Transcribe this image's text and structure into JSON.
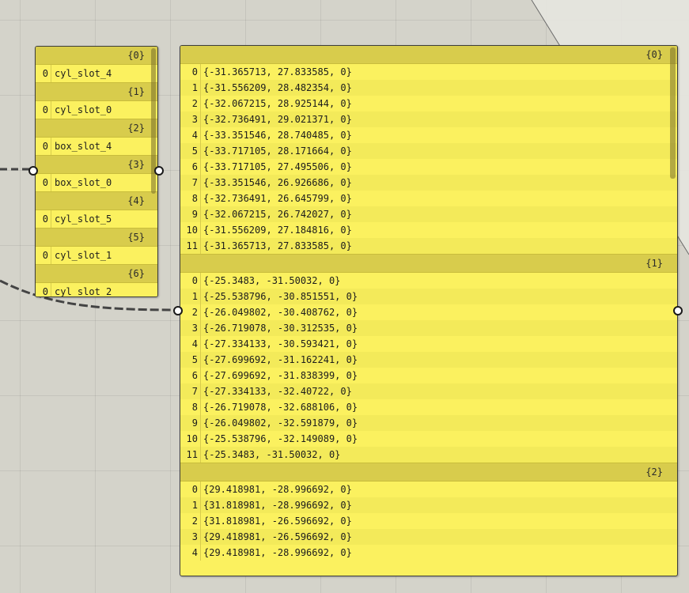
{
  "left_panel": {
    "branches": [
      {
        "path": "{0}",
        "items": [
          {
            "index": "0",
            "value": "cyl_slot_4"
          }
        ]
      },
      {
        "path": "{1}",
        "items": [
          {
            "index": "0",
            "value": "cyl_slot_0"
          }
        ]
      },
      {
        "path": "{2}",
        "items": [
          {
            "index": "0",
            "value": "box_slot_4"
          }
        ]
      },
      {
        "path": "{3}",
        "items": [
          {
            "index": "0",
            "value": "box_slot_0"
          }
        ]
      },
      {
        "path": "{4}",
        "items": [
          {
            "index": "0",
            "value": "cyl_slot_5"
          }
        ]
      },
      {
        "path": "{5}",
        "items": [
          {
            "index": "0",
            "value": "cyl_slot_1"
          }
        ]
      },
      {
        "path": "{6}",
        "items": [
          {
            "index": "0",
            "value": "cyl_slot_2"
          }
        ]
      }
    ]
  },
  "right_panel": {
    "branches": [
      {
        "path": "{0}",
        "items": [
          {
            "index": "0",
            "value": "{-31.365713, 27.833585, 0}"
          },
          {
            "index": "1",
            "value": "{-31.556209, 28.482354, 0}"
          },
          {
            "index": "2",
            "value": "{-32.067215, 28.925144, 0}"
          },
          {
            "index": "3",
            "value": "{-32.736491, 29.021371, 0}"
          },
          {
            "index": "4",
            "value": "{-33.351546, 28.740485, 0}"
          },
          {
            "index": "5",
            "value": "{-33.717105, 28.171664, 0}"
          },
          {
            "index": "6",
            "value": "{-33.717105, 27.495506, 0}"
          },
          {
            "index": "7",
            "value": "{-33.351546, 26.926686, 0}"
          },
          {
            "index": "8",
            "value": "{-32.736491, 26.645799, 0}"
          },
          {
            "index": "9",
            "value": "{-32.067215, 26.742027, 0}"
          },
          {
            "index": "10",
            "value": "{-31.556209, 27.184816, 0}"
          },
          {
            "index": "11",
            "value": "{-31.365713, 27.833585, 0}"
          }
        ]
      },
      {
        "path": "{1}",
        "items": [
          {
            "index": "0",
            "value": "{-25.3483, -31.50032, 0}"
          },
          {
            "index": "1",
            "value": "{-25.538796, -30.851551, 0}"
          },
          {
            "index": "2",
            "value": "{-26.049802, -30.408762, 0}"
          },
          {
            "index": "3",
            "value": "{-26.719078, -30.312535, 0}"
          },
          {
            "index": "4",
            "value": "{-27.334133, -30.593421, 0}"
          },
          {
            "index": "5",
            "value": "{-27.699692, -31.162241, 0}"
          },
          {
            "index": "6",
            "value": "{-27.699692, -31.838399, 0}"
          },
          {
            "index": "7",
            "value": "{-27.334133, -32.40722, 0}"
          },
          {
            "index": "8",
            "value": "{-26.719078, -32.688106, 0}"
          },
          {
            "index": "9",
            "value": "{-26.049802, -32.591879, 0}"
          },
          {
            "index": "10",
            "value": "{-25.538796, -32.149089, 0}"
          },
          {
            "index": "11",
            "value": "{-25.3483, -31.50032, 0}"
          }
        ]
      },
      {
        "path": "{2}",
        "items": [
          {
            "index": "0",
            "value": "{29.418981, -28.996692, 0}"
          },
          {
            "index": "1",
            "value": "{31.818981, -28.996692, 0}"
          },
          {
            "index": "2",
            "value": "{31.818981, -26.596692, 0}"
          },
          {
            "index": "3",
            "value": "{29.418981, -26.596692, 0}"
          },
          {
            "index": "4",
            "value": "{29.418981, -28.996692, 0}"
          }
        ]
      }
    ]
  }
}
